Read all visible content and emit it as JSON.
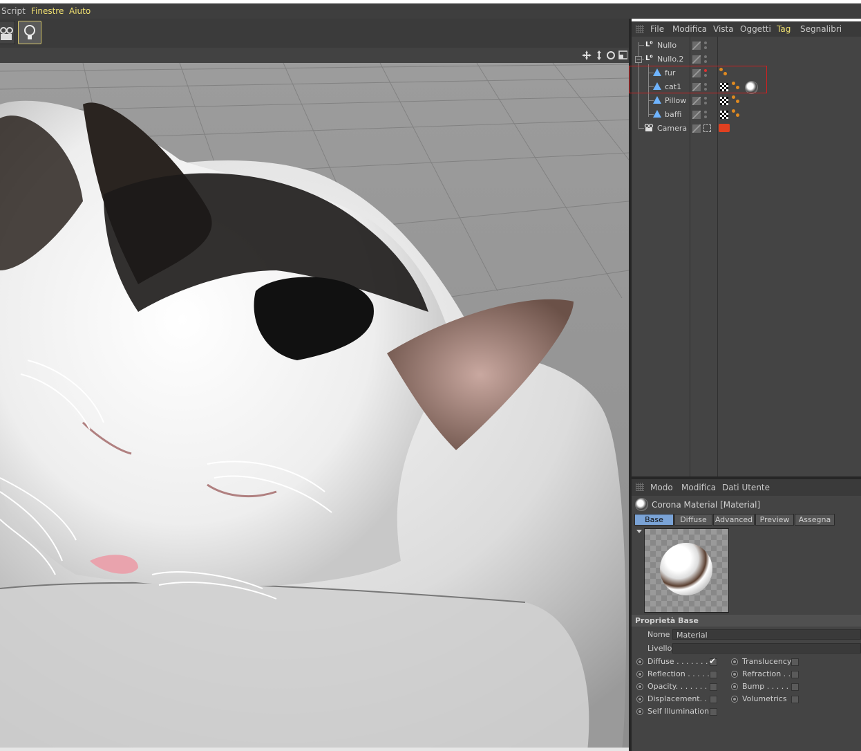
{
  "menubar": {
    "items": [
      {
        "label": "Script",
        "color": "#c8c8c8"
      },
      {
        "label": "Finestre",
        "color": "#f0e070"
      },
      {
        "label": "Aiuto",
        "color": "#f0e070"
      }
    ]
  },
  "object_manager": {
    "menu": [
      "File",
      "Modifica",
      "Vista",
      "Oggetti",
      "Tag",
      "Segnalibri"
    ],
    "highlight_menu": "Tag",
    "objects": [
      {
        "name": "Nullo",
        "type": "null"
      },
      {
        "name": "Nullo.2",
        "type": "null"
      },
      {
        "name": "fur",
        "type": "polygon"
      },
      {
        "name": "cat1",
        "type": "polygon"
      },
      {
        "name": "Pillow",
        "type": "polygon"
      },
      {
        "name": "baffi",
        "type": "polygon"
      },
      {
        "name": "Camera",
        "type": "camera"
      }
    ]
  },
  "attribute_manager": {
    "menu": [
      "Modo",
      "Modifica",
      "Dati Utente"
    ],
    "title": "Corona Material [Material]",
    "tabs": [
      "Base",
      "Diffuse",
      "Advanced",
      "Preview",
      "Assegna"
    ],
    "active_tab": "Base",
    "section": "Proprietà Base",
    "nome_label": "Nome",
    "nome_value": "Material",
    "livello_label": "Livello",
    "channels_left": [
      {
        "label": "Diffuse . . . . . . . . .",
        "checked": true
      },
      {
        "label": "Reflection . . . . .",
        "checked": false
      },
      {
        "label": "Opacity. . . . . . . . .",
        "checked": false
      },
      {
        "label": "Displacement. . .",
        "checked": false
      },
      {
        "label": "Self Illumination",
        "checked": false
      }
    ],
    "channels_right": [
      {
        "label": "Translucency",
        "checked": false
      },
      {
        "label": "Refraction . .",
        "checked": false
      },
      {
        "label": "Bump . . . . . . .",
        "checked": false
      },
      {
        "label": "Volumetrics",
        "checked": false
      }
    ]
  },
  "colors": {
    "panel_bg": "#444444",
    "accent_yellow": "#f0e070",
    "tab_active": "#7aa3d6",
    "selection_red": "#d02020"
  }
}
